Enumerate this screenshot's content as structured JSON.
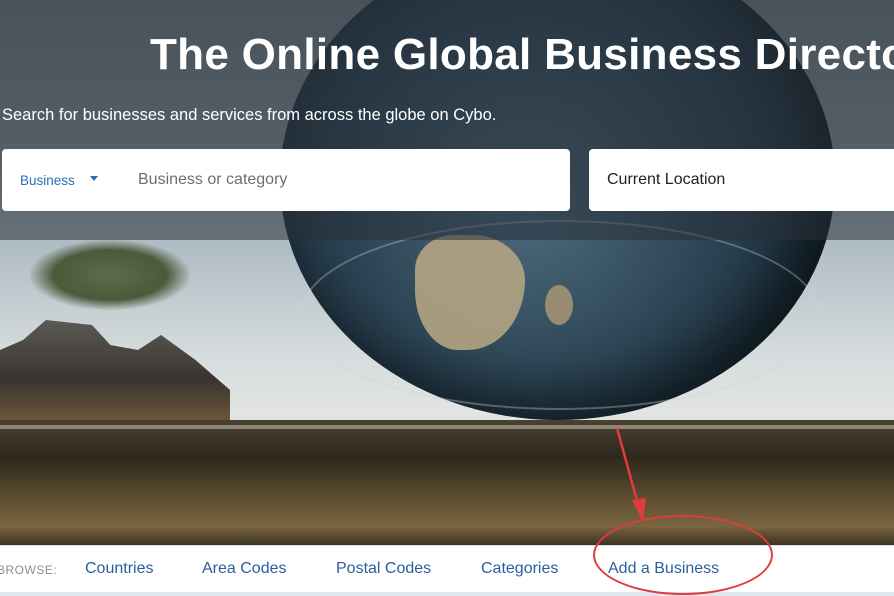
{
  "hero": {
    "title": "The Online Global Business Directory",
    "subtitle": "Search for businesses and services from across the globe on Cybo."
  },
  "search": {
    "type_selected": "Business",
    "query_placeholder": "Business or category",
    "location_placeholder": "Current Location"
  },
  "browse": {
    "label": "BROWSE:",
    "links": [
      "Countries",
      "Area Codes",
      "Postal Codes",
      "Categories",
      "Add a Business"
    ]
  },
  "colors": {
    "link": "#2a5f9e",
    "accent": "#2a6fb5",
    "annotation": "#e23b3b"
  }
}
